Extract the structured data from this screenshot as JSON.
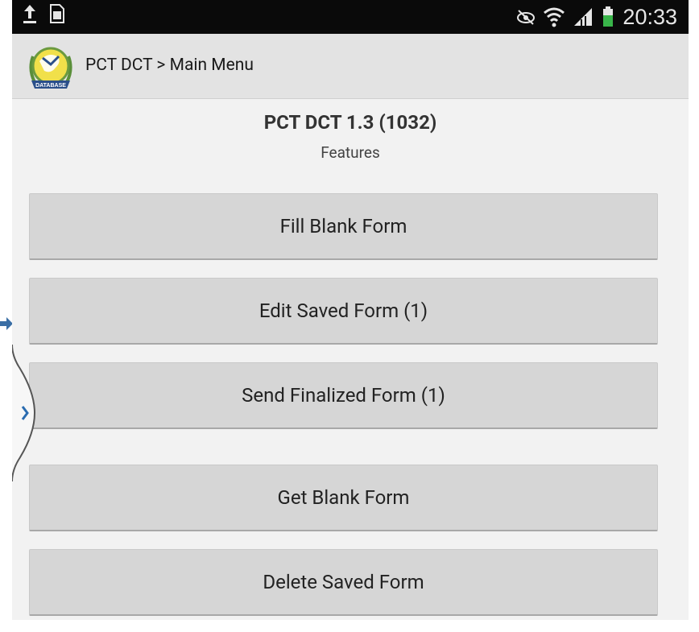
{
  "status_bar": {
    "time": "20:33",
    "icons": [
      "upload-icon",
      "sim-icon",
      "eye-icon",
      "wifi-icon",
      "signal-icon",
      "battery-icon"
    ]
  },
  "action_bar": {
    "title": "PCT DCT > Main Menu",
    "logo_text": "DATABASE"
  },
  "header": {
    "title": "PCT DCT 1.3 (1032)",
    "subtitle": "Features"
  },
  "menu": {
    "fill_blank_form": "Fill Blank Form",
    "edit_saved_form": "Edit Saved Form (1)",
    "send_finalized_form": "Send Finalized Form (1)",
    "get_blank_form": "Get Blank Form",
    "delete_saved_form": "Delete Saved Form"
  },
  "colors": {
    "status_bar": "#0a0a0a",
    "action_bar": "#e3e3e3",
    "background": "#f2f2f2",
    "button": "#d6d6d6",
    "edge_tab_accent": "#2b6cb0"
  }
}
